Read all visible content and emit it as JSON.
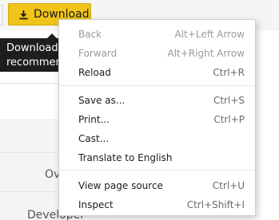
{
  "toolbar": {
    "download_label": "Download"
  },
  "tooltip": {
    "line1": "Download t",
    "line2": "recommende"
  },
  "background": {
    "text1": "Ov",
    "text2": "Developer"
  },
  "context_menu": {
    "items": [
      {
        "label": "Back",
        "shortcut": "Alt+Left Arrow",
        "disabled": true
      },
      {
        "label": "Forward",
        "shortcut": "Alt+Right Arrow",
        "disabled": true
      },
      {
        "label": "Reload",
        "shortcut": "Ctrl+R",
        "disabled": false
      },
      {
        "label": "Save as...",
        "shortcut": "Ctrl+S",
        "disabled": false
      },
      {
        "label": "Print...",
        "shortcut": "Ctrl+P",
        "disabled": false
      },
      {
        "label": "Cast...",
        "shortcut": "",
        "disabled": false
      },
      {
        "label": "Translate to English",
        "shortcut": "",
        "disabled": false
      },
      {
        "label": "View page source",
        "shortcut": "Ctrl+U",
        "disabled": false
      },
      {
        "label": "Inspect",
        "shortcut": "Ctrl+Shift+I",
        "disabled": false
      }
    ]
  },
  "colors": {
    "download_button": "#f0c419",
    "tooltip_bg": "#1e1e1e",
    "disabled_text": "#9a9a9a"
  }
}
